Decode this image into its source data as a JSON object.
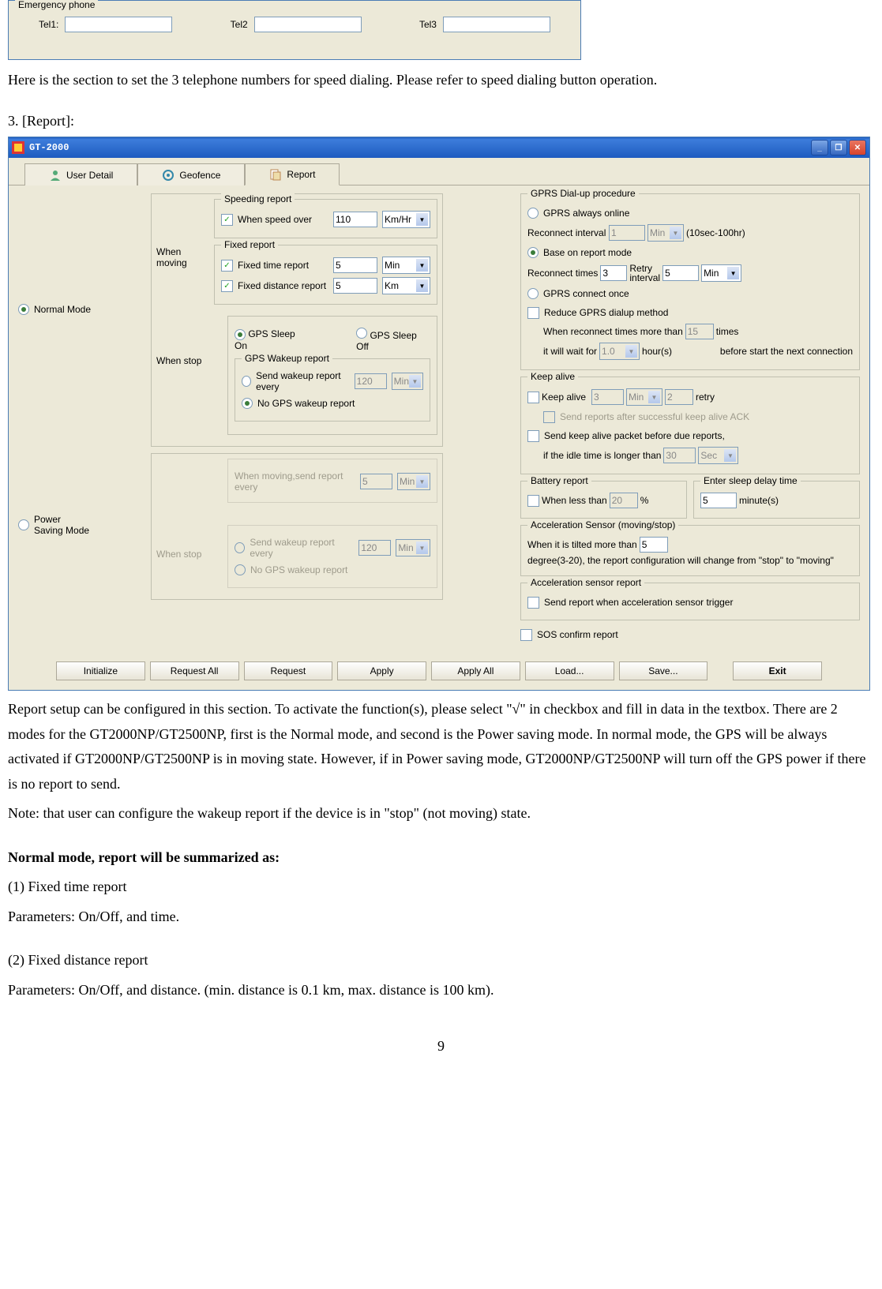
{
  "emergency": {
    "group_title": "Emergency phone",
    "tel1_label": "Tel1:",
    "tel2_label": "Tel2",
    "tel3_label": "Tel3",
    "tel1": "",
    "tel2": "",
    "tel3": ""
  },
  "intro1": "Here is the section to set the 3 telephone numbers for speed dialing. Please refer to speed dialing button operation.",
  "section_header": "3. [Report]:",
  "app": {
    "title": "GT-2000",
    "tabs": {
      "user": "User Detail",
      "geofence": "Geofence",
      "report": "Report"
    }
  },
  "mode": {
    "normal": "Normal Mode",
    "power": "Power\nSaving Mode",
    "when_moving": "When moving",
    "when_stop": "When stop",
    "power_moving_label": "When moving,send report every",
    "power_moving_val": "5",
    "power_moving_unit": "Min"
  },
  "speeding": {
    "title": "Speeding report",
    "cb": "When speed over",
    "val": "110",
    "unit": "Km/Hr"
  },
  "fixed": {
    "title": "Fixed report",
    "time_cb": "Fixed time report",
    "time_val": "5",
    "time_unit": "Min",
    "dist_cb": "Fixed distance report",
    "dist_val": "5",
    "dist_unit": "Km"
  },
  "sleep": {
    "on": "GPS Sleep On",
    "off": "GPS Sleep Off",
    "wakeup_title": "GPS Wakeup report",
    "send_label": "Send wakeup report every",
    "send_val": "120",
    "send_unit": "Min",
    "none": "No GPS wakeup report"
  },
  "gprs": {
    "title": "GPRS Dial-up procedure",
    "always": "GPRS always online",
    "reconnect_int": "Reconnect interval",
    "reconnect_int_val": "1",
    "reconnect_int_unit": "Min",
    "reconnect_int_note": "(10sec-100hr)",
    "base": "Base on report mode",
    "reconnect_times": "Reconnect times",
    "reconnect_times_val": "3",
    "retry_int": "Retry\ninterval",
    "retry_int_val": "5",
    "retry_int_unit": "Min",
    "once": "GPRS connect once",
    "reduce": "Reduce GPRS dialup method",
    "reduce1a": "When reconnect times more than",
    "reduce1_val": "15",
    "reduce1b": "times",
    "reduce2a": "it will wait for",
    "reduce2_val": "1.0",
    "reduce2b": "hour(s)",
    "reduce2c": "before start the next connection"
  },
  "keep": {
    "title": "Keep alive",
    "cb": "Keep alive",
    "v1": "3",
    "u1": "Min",
    "v2": "2",
    "retry": "retry",
    "ack": "Send reports after successful keep alive ACK",
    "before": "Send keep alive packet before due reports,",
    "idle": "if the idle time is longer than",
    "idle_val": "30",
    "idle_unit": "Sec"
  },
  "battery": {
    "title": "Battery report",
    "cb": "When less than",
    "val": "20",
    "pct": "%"
  },
  "sleepdelay": {
    "title": "Enter sleep delay time",
    "val": "5",
    "unit": "minute(s)"
  },
  "accel": {
    "title": "Acceleration Sensor (moving/stop)",
    "text1": "When it is tilted more than",
    "val": "5",
    "text2": "degree(3-20), the report configuration will change from \"stop\" to \"moving\""
  },
  "accelrep": {
    "title": "Acceleration sensor report",
    "cb": "Send report when acceleration sensor trigger"
  },
  "sos_cb": "SOS confirm report",
  "buttons": {
    "init": "Initialize",
    "reqall": "Request All",
    "req": "Request",
    "apply": "Apply",
    "applyall": "Apply All",
    "load": "Load...",
    "save": "Save...",
    "exit": "Exit"
  },
  "outro": {
    "p1": "Report setup can be configured in this section. To activate the function(s), please select \"√\" in checkbox and fill in data in the textbox. There are 2 modes for the GT2000NP/GT2500NP, first is the Normal mode, and second is the Power saving mode. In normal mode, the GPS will be always activated if GT2000NP/GT2500NP is in moving state. However, if in Power saving mode, GT2000NP/GT2500NP will turn off the GPS power if there is no report to send.",
    "p2": "Note: that user can configure the wakeup report if the device is in \"stop\" (not moving) state.",
    "h1": "Normal mode, report will be summarized as:",
    "i1a": "(1) Fixed time report",
    "i1b": "Parameters: On/Off, and time.",
    "i2a": "(2) Fixed distance report",
    "i2b": "Parameters: On/Off, and distance. (min. distance is 0.1 km, max. distance is 100 km).",
    "page": "9"
  }
}
